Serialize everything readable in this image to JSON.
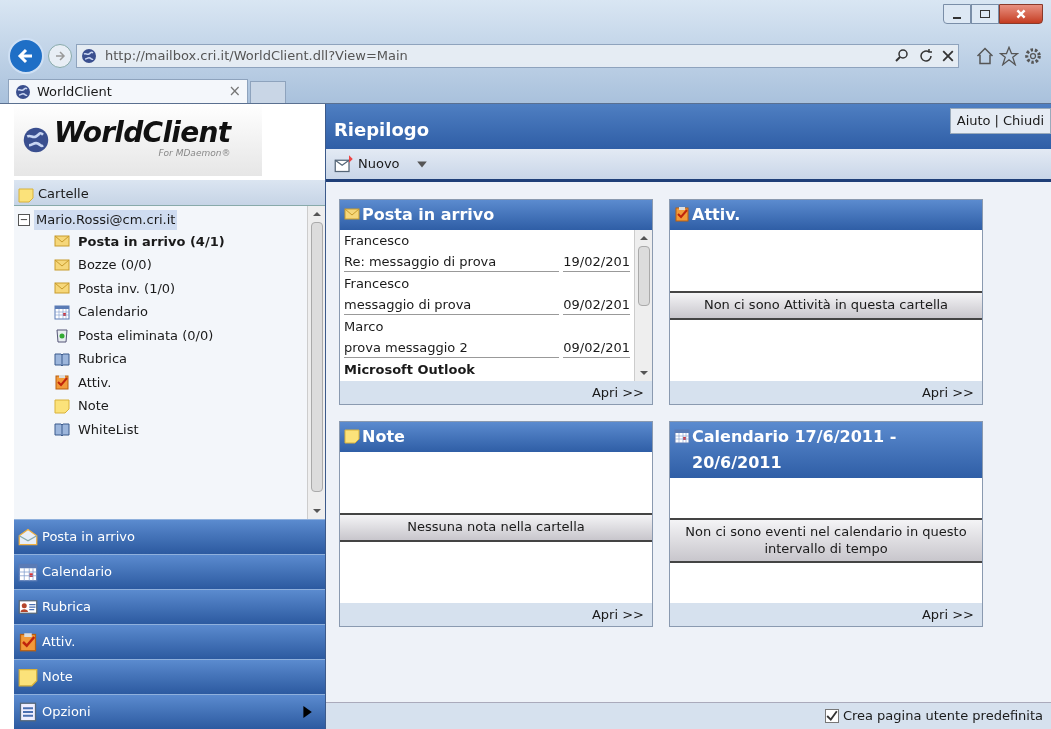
{
  "browser": {
    "url": "http://mailbox.cri.it/WorldClient.dll?View=Main",
    "tab": "WorldClient",
    "tab_close": "×"
  },
  "logo": {
    "name": "WorldClient",
    "tagline": "For MDaemon®"
  },
  "folders": {
    "header": "Cartelle",
    "account": {
      "label": "Mario.Rossi@cm.cri.it",
      "selected": true,
      "toggle": "−",
      "children": [
        {
          "label": "Posta in arrivo (4/1)",
          "kind": "mail",
          "unread": true
        },
        {
          "label": "Bozze (0/0)",
          "kind": "mail",
          "unread": false
        },
        {
          "label": "Posta inv. (1/0)",
          "kind": "mail",
          "unread": false
        },
        {
          "label": "Calendario",
          "kind": "calendar",
          "unread": false
        },
        {
          "label": "Posta eliminata (0/0)",
          "kind": "trash",
          "unread": false
        },
        {
          "label": "Rubrica",
          "kind": "book",
          "unread": false
        },
        {
          "label": "Attiv.",
          "kind": "task",
          "unread": false
        },
        {
          "label": "Note",
          "kind": "note",
          "unread": false
        },
        {
          "label": "WhiteList",
          "kind": "book",
          "unread": false
        }
      ]
    }
  },
  "nav": [
    {
      "label": "Posta in arrivo",
      "kind": "inbox"
    },
    {
      "label": "Calendario",
      "kind": "calendar"
    },
    {
      "label": "Rubrica",
      "kind": "contact"
    },
    {
      "label": "Attiv.",
      "kind": "task"
    },
    {
      "label": "Note",
      "kind": "note"
    },
    {
      "label": "Opzioni",
      "kind": "options",
      "submenu": true
    }
  ],
  "header": {
    "title": "Riepilogo",
    "help": "Aiuto",
    "separator": "|",
    "close": "Chiudi"
  },
  "toolbar": {
    "new": "Nuovo"
  },
  "cards": [
    {
      "kind": "mail",
      "title": "Posta in arrivo",
      "open": "Apri >>",
      "messages": [
        {
          "from": "Francesco",
          "subject": "Re: messaggio di prova",
          "date": "19/02/201"
        },
        {
          "from": "Francesco",
          "subject": "messaggio di prova",
          "date": "09/02/201"
        },
        {
          "from": "Marco",
          "subject": "prova messaggio 2",
          "date": "09/02/201"
        },
        {
          "from": "Microsoft Outlook"
        }
      ]
    },
    {
      "kind": "task",
      "title": "Attiv.",
      "open": "Apri >>",
      "empty": "Non ci sono Attività in questa cartella"
    },
    {
      "kind": "note",
      "title": "Note",
      "open": "Apri >>",
      "empty": "Nessuna nota nella cartella"
    },
    {
      "kind": "calendar",
      "title": "Calendario 17/6/2011 - 20/6/2011",
      "open": "Apri >>",
      "empty": "Non ci sono eventi nel calendario in questo intervallo di tempo"
    }
  ],
  "footer": {
    "label": "Crea pagina utente predefinita",
    "checked": true
  }
}
